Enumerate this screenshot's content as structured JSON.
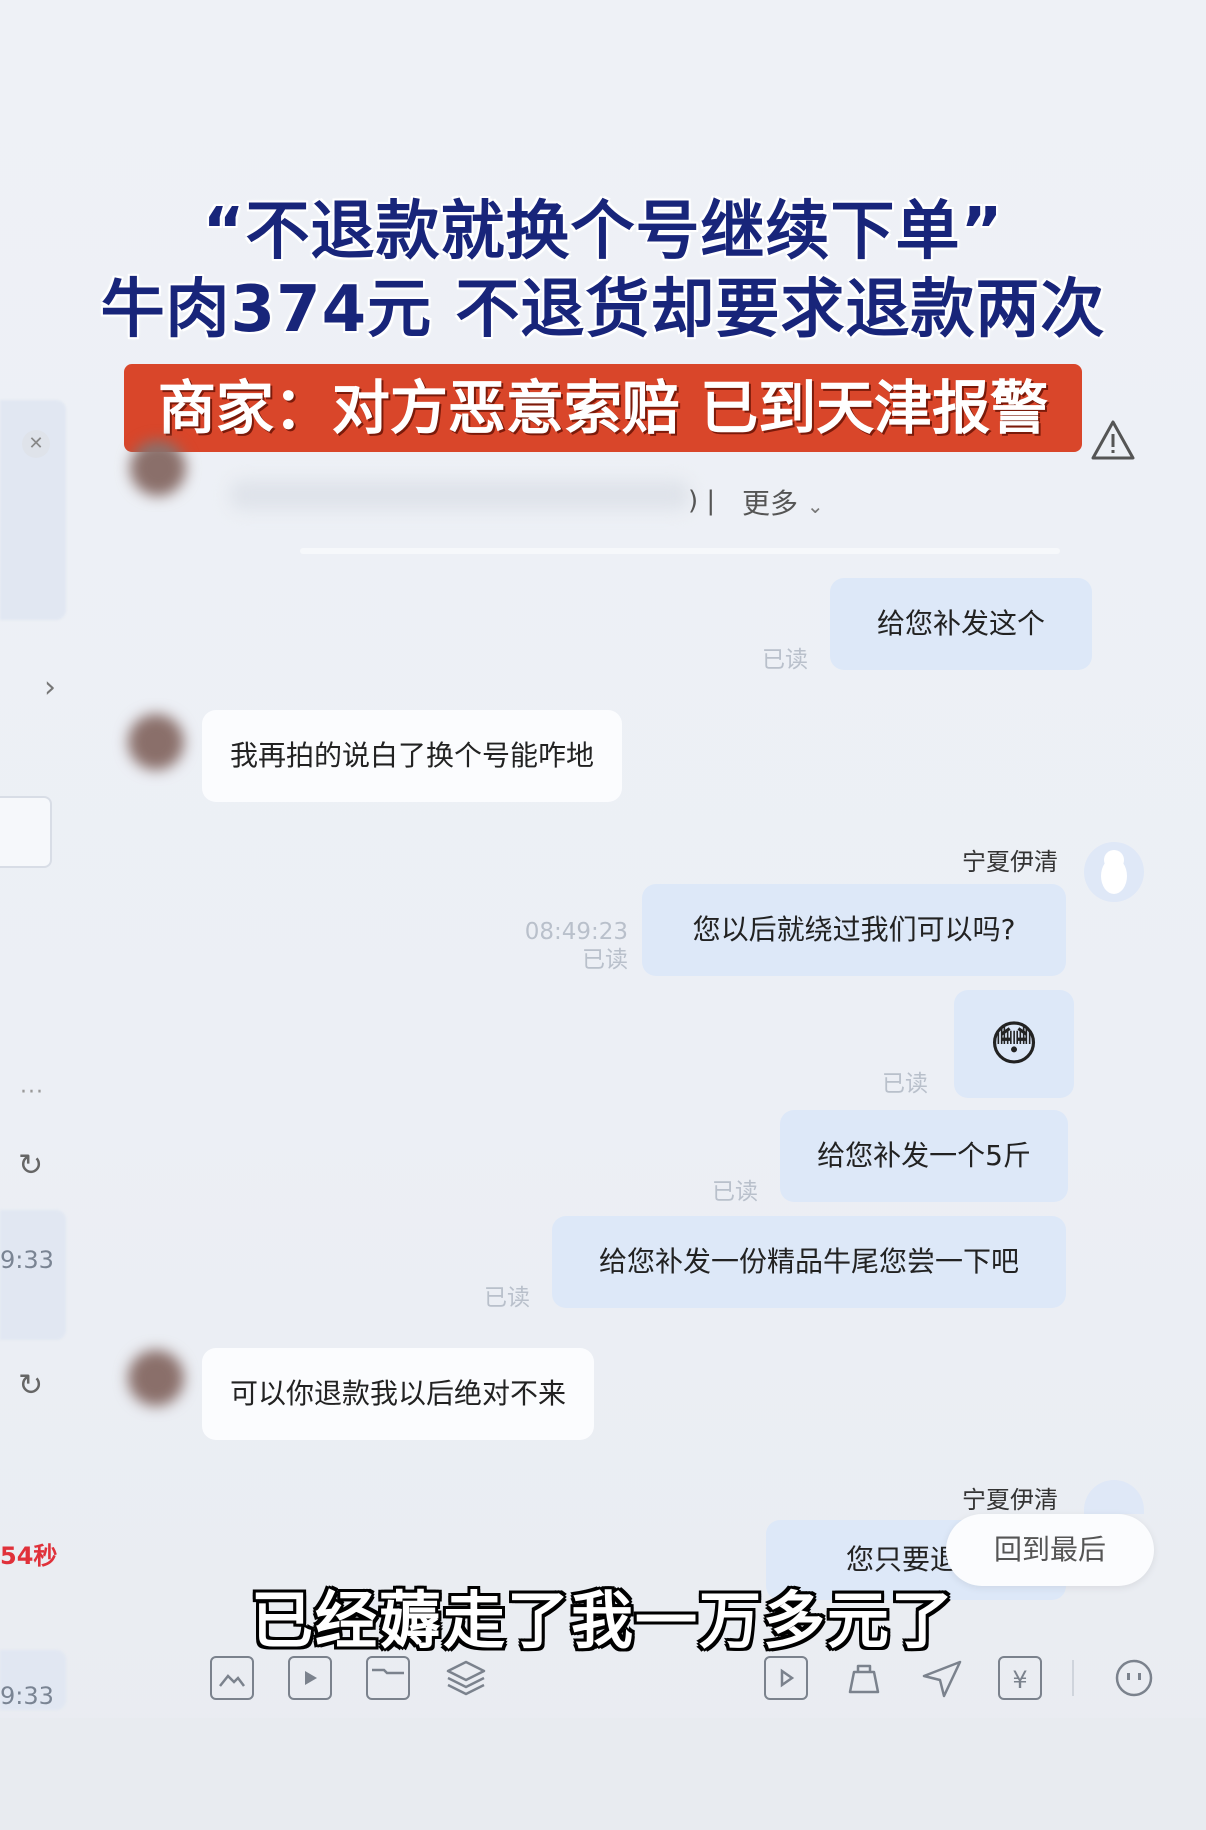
{
  "headline": {
    "line1": "“不退款就换个号继续下单”",
    "line2": "牛肉374元 不退货却要求退款两次",
    "line3": "商家：对方恶意索赔 已到天津报警"
  },
  "header": {
    "more_label": "更多",
    "warning_icon": "warning-icon"
  },
  "sidebar": {
    "close_icon": "close-icon",
    "chevron": "chevron-right-icon",
    "more_dots": "···",
    "times": [
      "9:33",
      "9:33"
    ],
    "countdown": "54秒"
  },
  "messages": [
    {
      "side": "right",
      "text": "给您补发这个",
      "status": "已读"
    },
    {
      "side": "left",
      "text": "我再拍的说白了换个号能咋地"
    },
    {
      "side": "right",
      "sender": "宁夏伊清",
      "text": "您以后就绕过我们可以吗?",
      "time": "08:49:23",
      "status": "已读"
    },
    {
      "side": "right",
      "emoji": "😳",
      "status": "已读"
    },
    {
      "side": "right",
      "text": "给您补发一个5斤",
      "status": "已读"
    },
    {
      "side": "right",
      "text": "给您补发一份精品牛尾您尝一下吧",
      "status": "已读"
    },
    {
      "side": "left",
      "text": "可以你退款我以后绝对不来"
    },
    {
      "side": "right",
      "sender": "宁夏伊清",
      "text": "您只要退款"
    }
  ],
  "jump_button": "回到最后",
  "subtitle": "已经薅走了我一万多元了",
  "toolbar": {
    "left_icons": [
      "image-icon",
      "video-icon",
      "folder-icon",
      "layers-icon"
    ],
    "right_icons": [
      "video-file-icon",
      "bag-icon",
      "send-icon",
      "coupon-icon",
      "emoji-icon"
    ]
  }
}
